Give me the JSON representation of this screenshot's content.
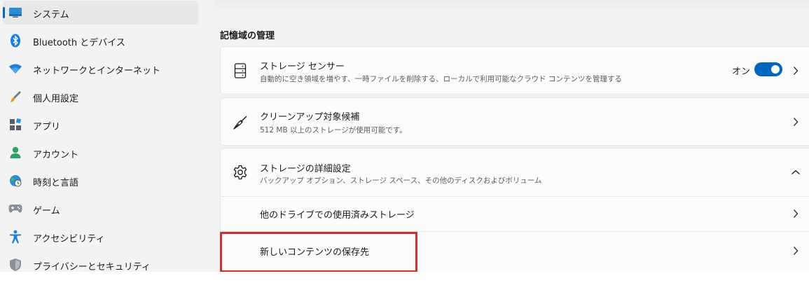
{
  "sidebar": {
    "items": [
      {
        "label": "システム",
        "icon": "system-monitor-icon",
        "selected": true
      },
      {
        "label": "Bluetooth とデバイス",
        "icon": "bluetooth-icon"
      },
      {
        "label": "ネットワークとインターネット",
        "icon": "wifi-icon"
      },
      {
        "label": "個人用設定",
        "icon": "paintbrush-icon"
      },
      {
        "label": "アプリ",
        "icon": "apps-icon"
      },
      {
        "label": "アカウント",
        "icon": "account-icon"
      },
      {
        "label": "時刻と言語",
        "icon": "time-language-icon"
      },
      {
        "label": "ゲーム",
        "icon": "gamepad-icon"
      },
      {
        "label": "アクセシビリティ",
        "icon": "accessibility-icon"
      },
      {
        "label": "プライバシーとセキュリティ",
        "icon": "shield-icon"
      }
    ]
  },
  "main": {
    "section_title": "記憶域の管理",
    "storage_sense": {
      "title": "ストレージ センサー",
      "description": "自動的に空き領域を増やす、一時ファイルを削除する、ローカルで利用可能なクラウド コンテンツを管理する",
      "toggle_label": "オン",
      "toggle_on": true
    },
    "cleanup": {
      "title": "クリーンアップ対象候補",
      "description": "512 MB 以上のストレージが使用可能です。"
    },
    "advanced": {
      "title": "ストレージの詳細設定",
      "description": "バックアップ オプション、ストレージ スペース、その他のディスクおよびボリューム",
      "expanded": true,
      "subitems": [
        {
          "label": "他のドライブでの使用済みストレージ"
        },
        {
          "label": "新しいコンテンツの保存先",
          "highlighted": true
        }
      ]
    }
  },
  "colors": {
    "accent": "#0067c0",
    "highlight": "#d0312d",
    "background": "#f3f3f3",
    "card": "#fbfbfb"
  }
}
